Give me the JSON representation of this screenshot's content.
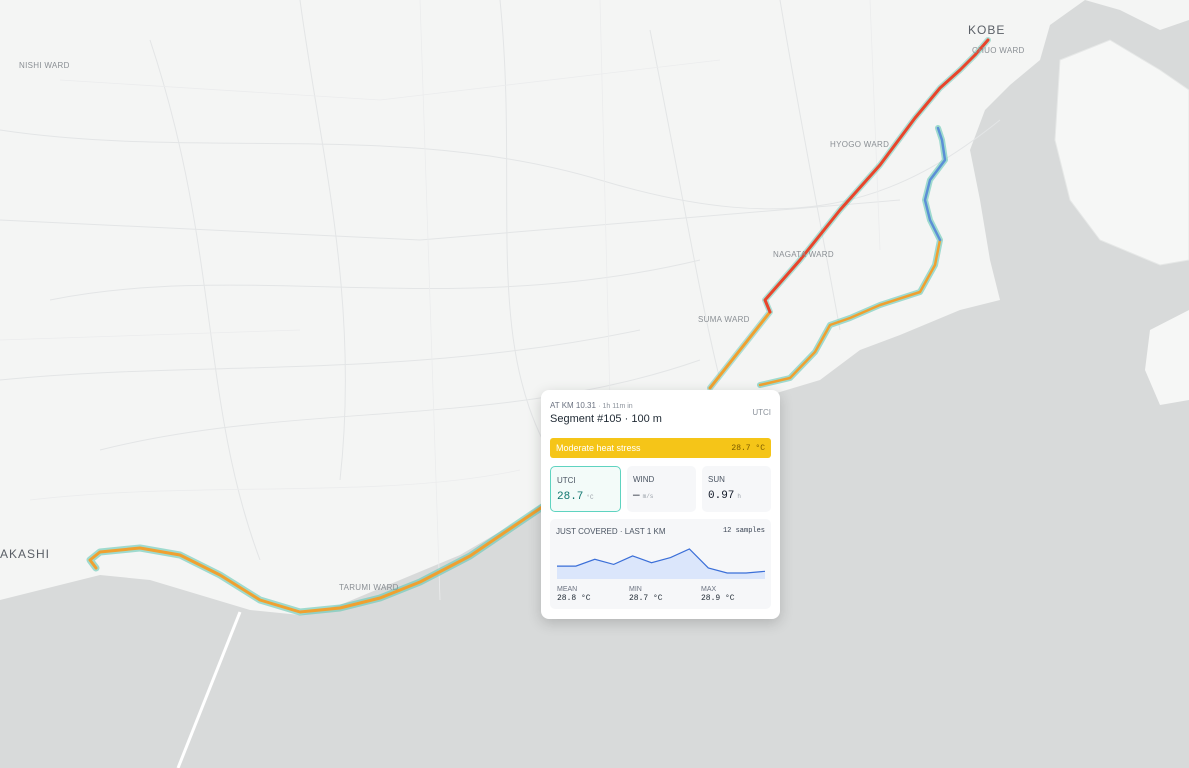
{
  "map": {
    "labels": [
      {
        "id": "nishi",
        "text": "NISHI WARD"
      },
      {
        "id": "kobe",
        "text": "KOBE"
      },
      {
        "id": "chuo",
        "text": "CHUO WARD"
      },
      {
        "id": "hyogo",
        "text": "HYOGO WARD"
      },
      {
        "id": "nagata",
        "text": "NAGATA WARD"
      },
      {
        "id": "suma",
        "text": "SUMA WARD"
      },
      {
        "id": "tarumi",
        "text": "TARUMI WARD"
      },
      {
        "id": "akashi",
        "text": "AKASHI"
      }
    ],
    "colors": {
      "water": "#d8dada",
      "land": "#f4f5f4",
      "road": "#e3e5e6",
      "hot": "#e8452c",
      "warm": "#f0a030",
      "cool": "#5b8fd6",
      "teal": "#64c8b4"
    }
  },
  "card": {
    "meta_km": "AT KM 10.31",
    "meta_elapsed": "1h 11m in",
    "tag": "UTCI",
    "title": "Segment #105 · 100 m",
    "stress_label": "Moderate heat stress",
    "stress_value": "28.7 °C",
    "stress_color": "#f5c518",
    "metrics": [
      {
        "label": "UTCI",
        "value": "28.7",
        "unit": "°C"
      },
      {
        "label": "WIND",
        "value": "—",
        "unit": "m/s"
      },
      {
        "label": "SUN",
        "value": "0.97",
        "unit": "h"
      }
    ],
    "spark_title": "JUST COVERED · LAST 1 KM",
    "samples": "12 samples",
    "stats": [
      {
        "label": "MEAN",
        "value": "28.8 °C"
      },
      {
        "label": "MIN",
        "value": "28.7 °C"
      },
      {
        "label": "MAX",
        "value": "28.9 °C"
      }
    ],
    "spark_values": [
      28.74,
      28.74,
      28.78,
      28.75,
      28.8,
      28.76,
      28.79,
      28.84,
      28.73,
      28.7,
      28.7,
      28.71
    ]
  }
}
